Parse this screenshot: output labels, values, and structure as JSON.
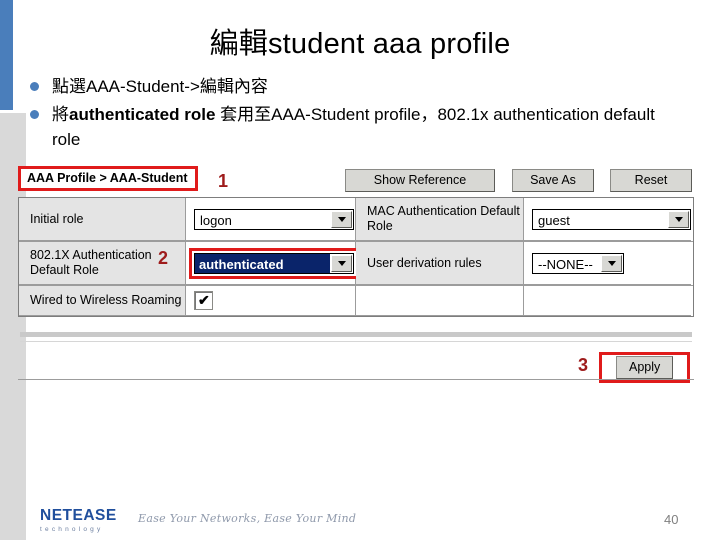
{
  "slide": {
    "title": "編輯student aaa profile",
    "page_number": "40",
    "accent_blue": "#4a7ebb",
    "annotation_red": "#9e1b1b",
    "highlight_red": "#e01b1b"
  },
  "bullets": [
    {
      "text": "點選AAA-Student->編輯內容",
      "bold_part": ""
    },
    {
      "text_before": "將",
      "text_bold": "authenticated role",
      "text_after": " 套用至AAA-Student profile，802.1x authentication default role"
    }
  ],
  "app": {
    "breadcrumb": "AAA Profile > AAA-Student",
    "buttons": {
      "show_reference": "Show Reference",
      "save_as": "Save As",
      "reset": "Reset",
      "apply": "Apply"
    },
    "annotations": {
      "one": "1",
      "two": "2",
      "three": "3"
    },
    "rows": [
      {
        "left_label": "Initial role",
        "left_value": "logon",
        "right_label": "MAC Authentication Default Role",
        "right_value": "guest"
      },
      {
        "left_label": "802.1X Authentication Default Role",
        "left_value": "authenticated",
        "right_label": "User derivation rules",
        "right_value": "--NONE--"
      },
      {
        "left_label": "Wired to Wireless Roaming",
        "left_value": "checked",
        "right_label": "",
        "right_value": ""
      }
    ]
  },
  "footer": {
    "logo_word": "NETEASE",
    "logo_sub": "technology",
    "tagline": "Ease Your Networks, Ease Your Mind"
  }
}
